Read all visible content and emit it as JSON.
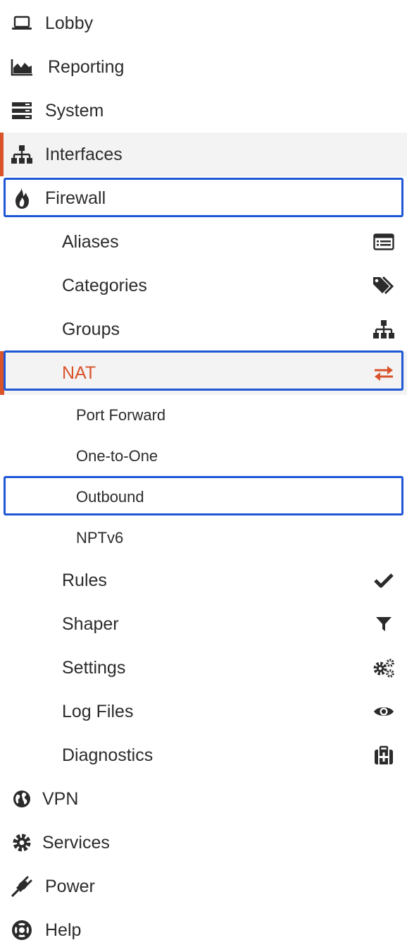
{
  "menu": {
    "lobby": "Lobby",
    "reporting": "Reporting",
    "system": "System",
    "interfaces": "Interfaces",
    "firewall": "Firewall",
    "firewall_items": {
      "aliases": "Aliases",
      "categories": "Categories",
      "groups": "Groups",
      "nat": "NAT",
      "nat_items": {
        "port_forward": "Port Forward",
        "one_to_one": "One-to-One",
        "outbound": "Outbound",
        "nptv6": "NPTv6"
      },
      "rules": "Rules",
      "shaper": "Shaper",
      "settings": "Settings",
      "log_files": "Log Files",
      "diagnostics": "Diagnostics"
    },
    "vpn": "VPN",
    "services": "Services",
    "power": "Power",
    "help": "Help"
  },
  "colors": {
    "accent": "#d9532b",
    "highlight_border": "#1f57d6",
    "active_bg": "#f3f3f3",
    "icon": "#2b2b2b"
  }
}
